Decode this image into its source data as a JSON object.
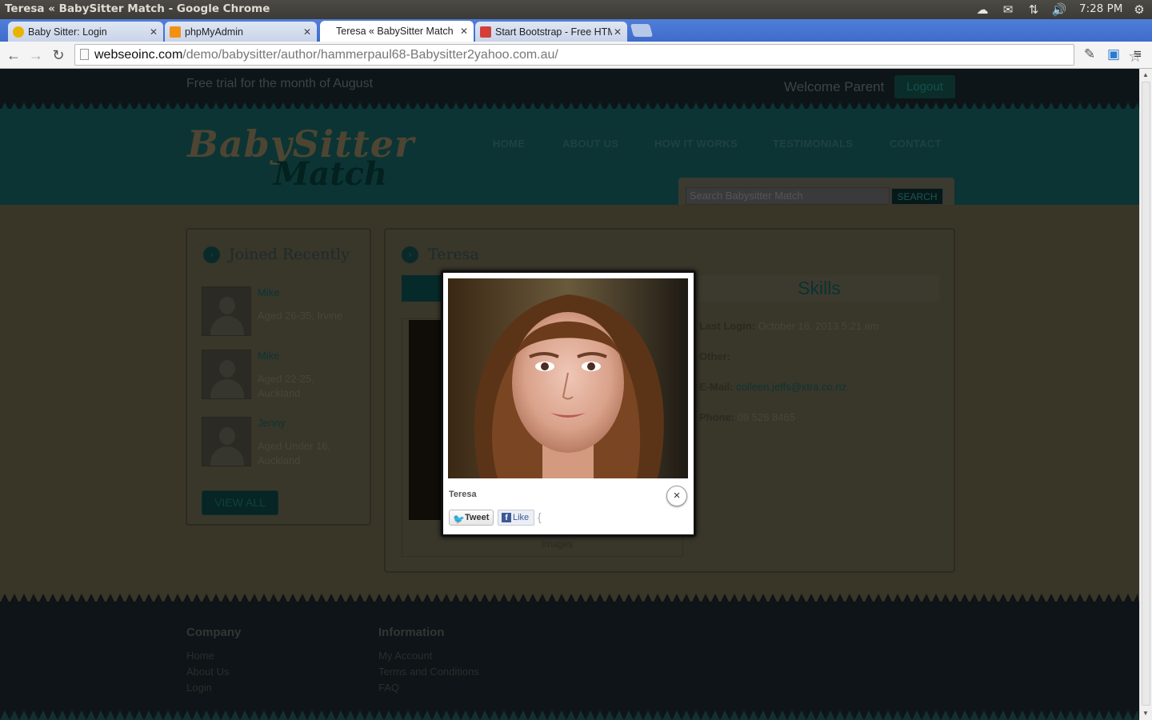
{
  "os": {
    "window_title": "Teresa « BabySitter Match - Google Chrome",
    "clock": "7:28 PM"
  },
  "browser": {
    "tabs": [
      {
        "label": "Baby Sitter: Login",
        "favicon_color": "#e8b400"
      },
      {
        "label": "phpMyAdmin",
        "favicon_color": "#f29111"
      },
      {
        "label": "Teresa « BabySitter Match",
        "favicon_color": "#ffffff"
      },
      {
        "label": "Start Bootstrap - Free HTML",
        "favicon_color": "#d43f3a"
      }
    ],
    "url_host": "webseoinc.com",
    "url_path": "/demo/babysitter/author/hammerpaul68-Babysitter2yahoo.com.au/"
  },
  "site": {
    "trial_text": "Free trial for the month of August",
    "welcome": "Welcome Parent",
    "logout": "Logout",
    "logo_line1": "BabySitter",
    "logo_line2": "Match",
    "nav": [
      "HOME",
      "ABOUT US",
      "HOW IT WORKS",
      "TESTIMONIALS",
      "CONTACT"
    ],
    "search_placeholder": "Search Babysitter Match",
    "search_button": "SEARCH"
  },
  "sidebar": {
    "title": "Joined Recently",
    "members": [
      {
        "name": "Mike",
        "desc": "Aged 26-35, Irvine"
      },
      {
        "name": "Mike",
        "desc": "Aged 22-25, Auckland"
      },
      {
        "name": "Jenny",
        "desc": "Aged Under 16, Auckland"
      }
    ],
    "view_all": "VIEW ALL"
  },
  "profile": {
    "name": "Teresa",
    "skills_heading": "Skills",
    "images_label": "Images",
    "last_login_label": "Last Login:",
    "last_login_value": "October 16, 2013 5:21 am",
    "other_label": "Other:",
    "email_label": "E-Mail:",
    "email_value": "colleen.jeffs@xtra.co.nz",
    "phone_label": "Phone:",
    "phone_value": "09 526 8465"
  },
  "footer": {
    "company_title": "Company",
    "company_links": [
      "Home",
      "About Us",
      "Login"
    ],
    "info_title": "Information",
    "info_links": [
      "My Account",
      "Terms and Conditions",
      "FAQ"
    ]
  },
  "lightbox": {
    "caption": "Teresa",
    "tweet": "Tweet",
    "like": "Like",
    "close": "×"
  }
}
